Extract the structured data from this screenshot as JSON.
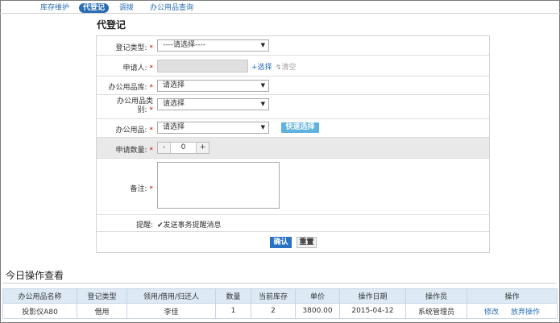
{
  "tabs": [
    "库存维护",
    "代登记",
    "调拨",
    "办公用品查询"
  ],
  "form": {
    "title": "代登记",
    "register_type": {
      "label": "登记类型:",
      "value": "----请选择----"
    },
    "applicant": {
      "label": "申请人:",
      "select_link": "选择",
      "clear_link": "清空"
    },
    "warehouse": {
      "label": "办公用品库:",
      "value": "请选择"
    },
    "category": {
      "label_line1": "办公用品类",
      "label_line2": "别:",
      "value": "请选择"
    },
    "item": {
      "label": "办公用品:",
      "value": "请选择",
      "quick_button": "快速选择"
    },
    "quantity": {
      "label": "申请数量:",
      "minus": "-",
      "value": "0",
      "plus": "+"
    },
    "remark": {
      "label": "备注:"
    },
    "reminder": {
      "label": "提醒:",
      "checkbox_label": "发送事务提醒消息"
    },
    "buttons": {
      "ok": "确认",
      "reset": "重置"
    },
    "required_mark": "*"
  },
  "today": {
    "title": "今日操作查看",
    "columns": [
      "办公用品名称",
      "登记类型",
      "领用/借用/归还人",
      "数量",
      "当前库存",
      "单价",
      "操作日期",
      "操作员",
      "操作"
    ],
    "rows": [
      {
        "name": "投影仪A80",
        "type": "借用",
        "person": "李佳",
        "qty": "1",
        "stock": "2",
        "price": "3800.00",
        "date": "2015-04-12",
        "operator": "系统管理员",
        "action_edit": "修改",
        "action_cancel": "放弃操作"
      }
    ]
  }
}
